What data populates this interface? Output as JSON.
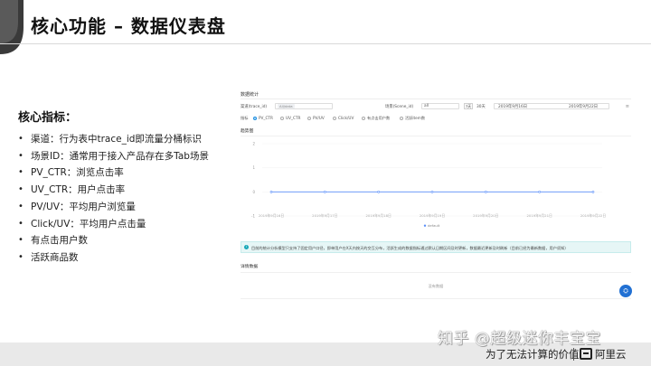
{
  "slide": {
    "title": "核心功能 – 数据仪表盘"
  },
  "left": {
    "heading": "核心指标：",
    "bullets": [
      "渠道：行为表中trace_id即流量分桶标识",
      "场景ID：通常用于接入产品存在多Tab场景",
      "PV_CTR：浏览点击率",
      "UV_CTR：用户点击率",
      "PV/UV：平均用户浏览量",
      "Click/UV：平均用户点击量",
      "有点击用户数",
      "活跃商品数"
    ]
  },
  "dashboard": {
    "title": "数据统计",
    "filters": {
      "channel_label": "渠道(trace_id)",
      "channel_tag": "All/data",
      "scene_label": "场景(Scene_id)",
      "scene_value": "all",
      "period_btn_1": "7天",
      "period_btn_2": "30天",
      "date_start": "2019年9月16日",
      "date_end": "2019年9月22日",
      "menu_icon": "≡"
    },
    "metrics": {
      "label": "指标",
      "options": [
        {
          "label": "PV_CTR",
          "selected": true
        },
        {
          "label": "UV_CTR",
          "selected": false
        },
        {
          "label": "PV/UV",
          "selected": false
        },
        {
          "label": "Click/UV",
          "selected": false
        },
        {
          "label": "有点击用户数",
          "selected": false
        },
        {
          "label": "活跃item数",
          "selected": false
        }
      ]
    },
    "chart_title": "趋势图",
    "chart_data": {
      "type": "line",
      "x": [
        "2019年9月16日",
        "2019年9月17日",
        "2019年9月18日",
        "2019年9月19日",
        "2019年9月20日",
        "2019年9月21日",
        "2019年9月22日"
      ],
      "series": [
        {
          "name": "default",
          "values": [
            0,
            0,
            0,
            0,
            0,
            0,
            0
          ]
        }
      ],
      "yticks": [
        "2",
        "1",
        "0",
        "-1"
      ],
      "ylim": [
        -1,
        2
      ],
      "grid": true,
      "legend": "bottom",
      "color": "#5b8ff9"
    },
    "notice": "目前的统计分析模型只支持了固定用户口径，即单用户在X天内按天的交互分布，活跃生成的数据指标通过默认日期区间及时更新，数据最近更新及时刷新（目前已经为最新数据，用户须知）",
    "detail_title": "详情数据",
    "detail_empty": "没有数据",
    "float_icon": "⛭"
  },
  "footer": {
    "slogan": "为了无法计算的价值",
    "brand": "阿里云"
  },
  "watermark": "知乎 @超级迷你丰宝宝"
}
